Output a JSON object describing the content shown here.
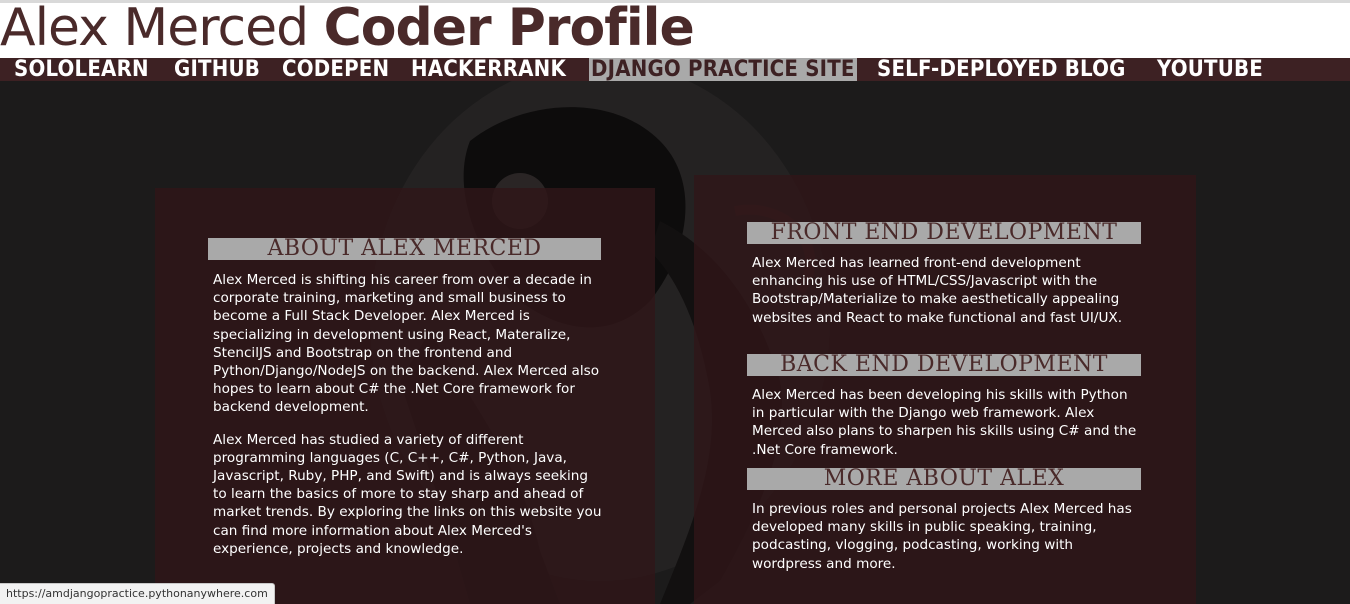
{
  "header": {
    "title_part1": "Alex Merced",
    "title_part2": "Coder Profile"
  },
  "nav": {
    "items": [
      {
        "label": "SOLOLEARN"
      },
      {
        "label": "GITHUB"
      },
      {
        "label": "CODEPEN"
      },
      {
        "label": "HACKERRANK"
      },
      {
        "label": "DJANGO PRACTICE SITE"
      },
      {
        "label": "SELF-DEPLOYED BLOG"
      },
      {
        "label": "YOUTUBE"
      }
    ],
    "active_index": 4
  },
  "about": {
    "heading": "ABOUT ALEX MERCED",
    "paragraph1": "Alex Merced is shifting his career from over a decade in corporate training, marketing and small business to become a Full Stack Developer. Alex Merced is specializing in development using React, Materalize, StencilJS and Bootstrap on the frontend and Python/Django/NodeJS on the backend. Alex Merced also hopes to learn about C# the .Net Core framework for backend development.",
    "paragraph2": "Alex Merced has studied a variety of different programming languages (C, C++, C#, Python, Java, Javascript, Ruby, PHP, and Swift) and is always seeking to learn the basics of more to stay sharp and ahead of market trends. By exploring the links on this website you can find more information about Alex Merced's experience, projects and knowledge."
  },
  "skills": {
    "frontend_heading": "FRONT END DEVELOPMENT",
    "frontend_text": "Alex Merced has learned front-end development enhancing his use of HTML/CSS/Javascript with the Bootstrap/Materialize to make aesthetically appealing websites and React to make functional and fast UI/UX.",
    "backend_heading": "BACK END DEVELOPMENT",
    "backend_text": "Alex Merced has been developing his skills with Python in particular with the Django web framework. Alex Merced also plans to sharpen his skills using C# and the .Net Core framework.",
    "more_heading": "MORE ABOUT ALEX",
    "more_text": "In previous roles and personal projects Alex Merced has developed many skills in public speaking, training, podcasting, vlogging, podcasting, working with wordpress and more."
  },
  "status_bar": {
    "url": "https://amdjangopractice.pythonanywhere.com"
  },
  "colors": {
    "accent": "#3d2123",
    "heading_bg": "#a9a9a9",
    "heading_text": "#4a2a2a",
    "page_bg": "#1c1b1b"
  }
}
